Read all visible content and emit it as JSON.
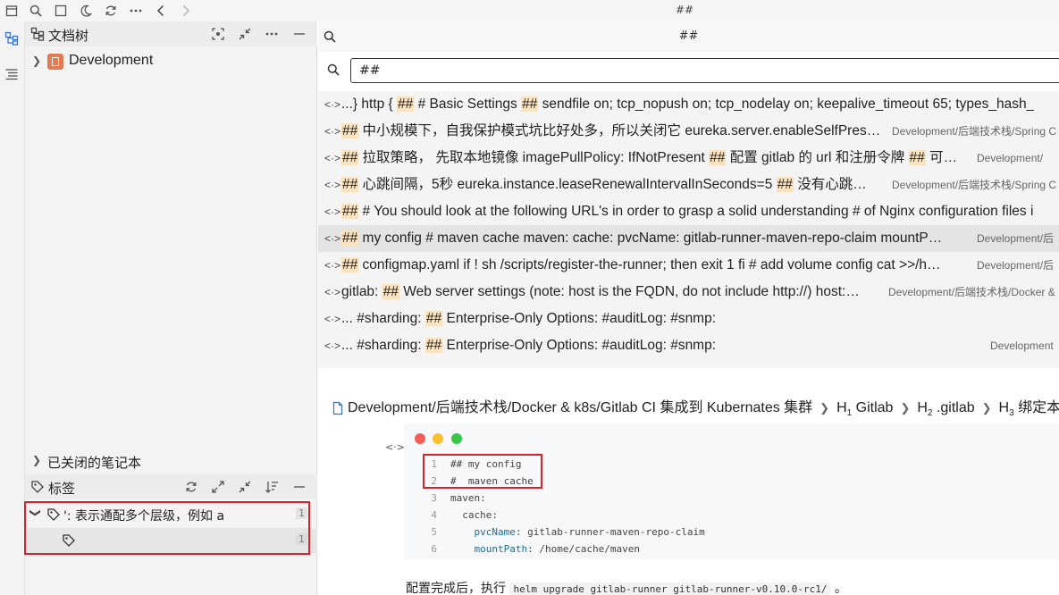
{
  "window": {
    "title": "##"
  },
  "colors": {
    "highlight": "#fbe3bf",
    "annotation_red": "#d9232a",
    "notebook_icon": "#e07b53"
  },
  "toolbar": {
    "icons": [
      "calendar-icon",
      "search-icon",
      "square-icon",
      "moon-icon",
      "sync-icon",
      "more-icon",
      "back-arrow-icon",
      "forward-arrow-icon"
    ]
  },
  "rail": {
    "icons": [
      "tree-icon",
      "outline-icon"
    ]
  },
  "doc_tree": {
    "title": "文档树",
    "notebooks": [
      {
        "label": "Development"
      }
    ],
    "closed_notebooks": "已关闭的笔记本"
  },
  "tags": {
    "title": "标签",
    "items": [
      {
        "label": "': 表示通配多个层级，例如 a",
        "count": "1"
      },
      {
        "label": "",
        "count": "1"
      }
    ]
  },
  "search": {
    "panel_title": "##",
    "query": "##",
    "results": [
      {
        "segments": [
          [
            "",
            "...} http { "
          ],
          [
            "mk",
            "##"
          ],
          [
            "",
            " # Basic Settings "
          ],
          [
            "mk",
            "##"
          ],
          [
            "",
            " sendfile on; tcp_nopush on; tcp_nodelay on; keepalive_timeout 65; types_hash_"
          ]
        ],
        "path": ""
      },
      {
        "segments": [
          [
            "mk",
            "##"
          ],
          [
            "",
            " 中小规模下，自我保护模式坑比好处多，所以关闭它 eureka.server.enableSelfPres…"
          ]
        ],
        "path": "Development/后端技术栈/Spring C"
      },
      {
        "segments": [
          [
            "mk",
            "##"
          ],
          [
            "",
            " 拉取策略， 先取本地镜像 imagePullPolicy: IfNotPresent "
          ],
          [
            "mk",
            "##"
          ],
          [
            "",
            " 配置 gitlab 的 url 和注册令牌 "
          ],
          [
            "mk",
            "##"
          ],
          [
            "",
            " 可…"
          ]
        ],
        "path": "Development/"
      },
      {
        "segments": [
          [
            "mk",
            "##"
          ],
          [
            "",
            " 心跳间隔，5秒 eureka.instance.leaseRenewalIntervalInSeconds=5 "
          ],
          [
            "mk",
            "##"
          ],
          [
            "",
            " 没有心跳…"
          ]
        ],
        "path": "Development/后端技术栈/Spring C"
      },
      {
        "segments": [
          [
            "mk",
            "##"
          ],
          [
            "",
            " # You should look at the following URL's in order to grasp a solid understanding # of Nginx configuration files i"
          ]
        ],
        "path": ""
      },
      {
        "segments": [
          [
            "mk",
            "##"
          ],
          [
            "",
            " my config # maven cache maven: cache: pvcName: gitlab-runner-maven-repo-claim mountP…"
          ]
        ],
        "path": "Development/后"
      },
      {
        "segments": [
          [
            "mk",
            "##"
          ],
          [
            "",
            " configmap.yaml if ! sh /scripts/register-the-runner; then exit 1 fi # add volume config cat >>/h…"
          ]
        ],
        "path": "Development/后"
      },
      {
        "segments": [
          [
            "",
            "gitlab: "
          ],
          [
            "mk",
            "##"
          ],
          [
            "",
            " Web server settings (note: host is the FQDN, do not include http://) host:…"
          ]
        ],
        "path": "Development/后端技术栈/Docker &"
      },
      {
        "segments": [
          [
            "",
            "... #sharding: "
          ],
          [
            "mk",
            "##"
          ],
          [
            "",
            " Enterprise-Only Options: #auditLog: #snmp:"
          ]
        ],
        "path": ""
      },
      {
        "segments": [
          [
            "",
            "... #sharding: "
          ],
          [
            "mk",
            "##"
          ],
          [
            "",
            " Enterprise-Only Options: #auditLog: #snmp:"
          ]
        ],
        "path": "Development"
      }
    ]
  },
  "breadcrumb": {
    "path": "Development/后端技术栈/Docker & k8s/Gitlab CI 集成到 Kubernates 集群",
    "h1": "Gitlab",
    "h2": ".gitlab",
    "h3": "绑定本地"
  },
  "code": {
    "lines": [
      {
        "n": "1",
        "text": "## my config",
        "kind": "comment"
      },
      {
        "n": "2",
        "text": "#  maven cache",
        "kind": "comment"
      },
      {
        "n": "3",
        "text": "maven:",
        "kind": "key"
      },
      {
        "n": "4",
        "text": "  cache:",
        "kind": "key"
      },
      {
        "n": "5",
        "text": "    pvcName: gitlab-runner-maven-repo-claim",
        "kind": "kv"
      },
      {
        "n": "6",
        "text": "    mountPath: /home/cache/maven",
        "kind": "kv"
      }
    ]
  },
  "footer": {
    "before": "配置完成后，执行 ",
    "code": "helm upgrade gitlab-runner gitlab-runner-v0.10.0-rc1/",
    "after": " 。"
  }
}
